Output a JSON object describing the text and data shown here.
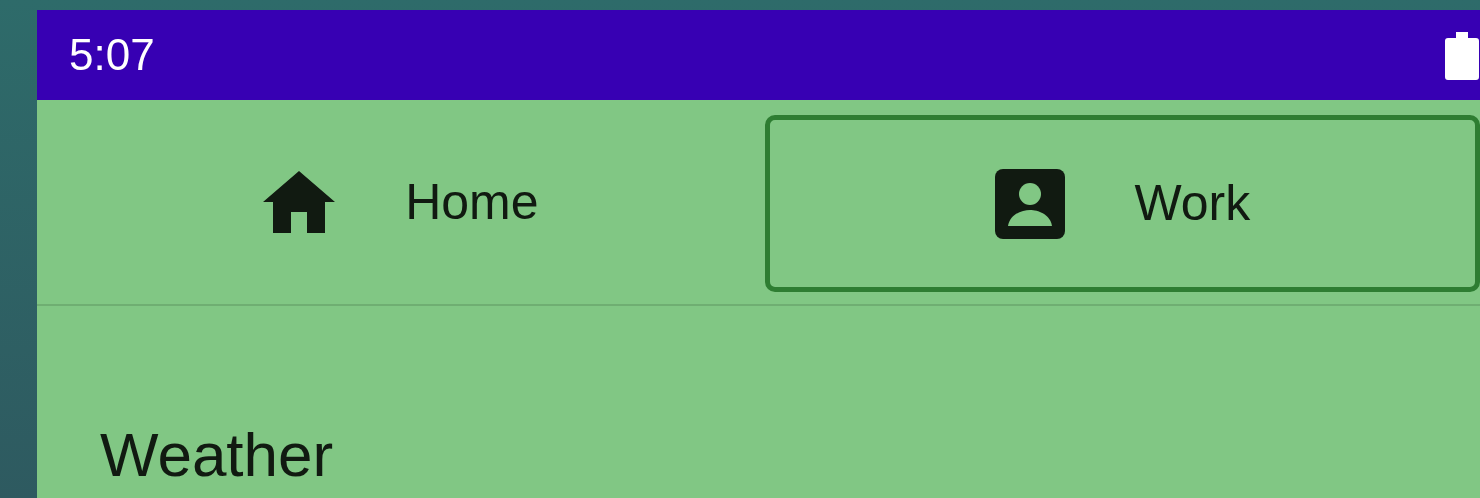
{
  "status_bar": {
    "time": "5:07"
  },
  "tabs": [
    {
      "label": "Home",
      "selected": false
    },
    {
      "label": "Work",
      "selected": true
    }
  ],
  "content": {
    "heading": "Weather"
  }
}
